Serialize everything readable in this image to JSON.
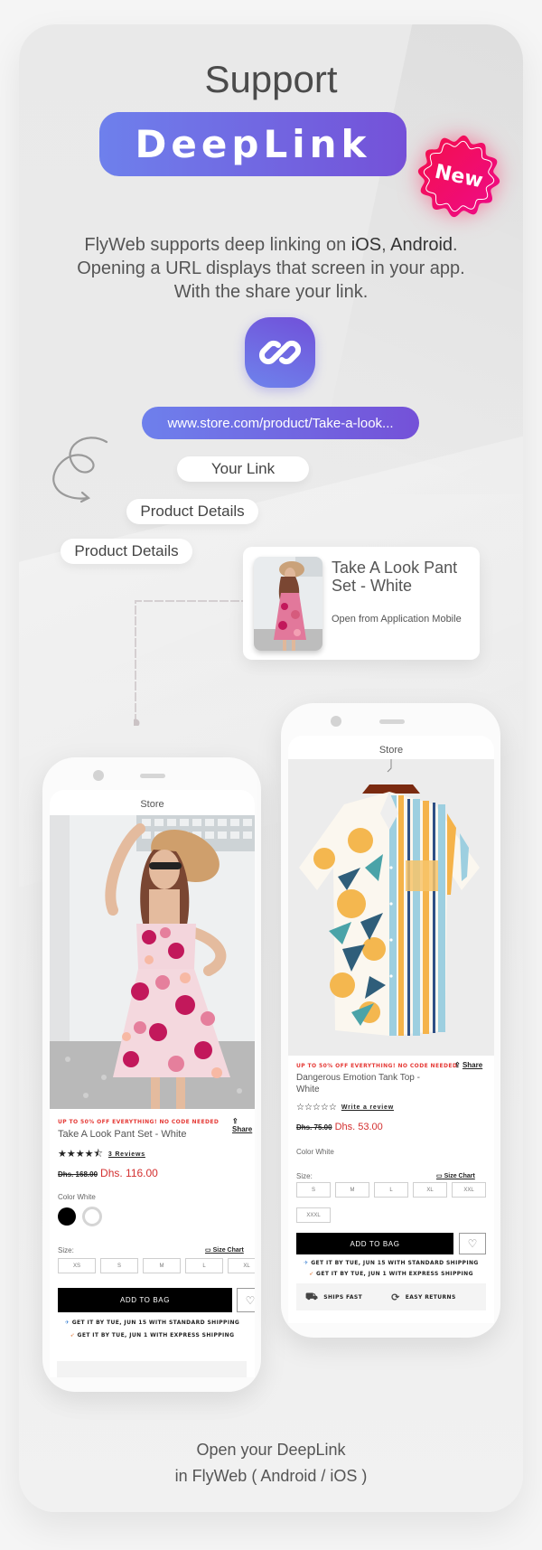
{
  "header": {
    "title": "Support",
    "badge_label": "DeepLink",
    "new_badge": "New",
    "description": {
      "line1_prefix": "FlyWeb supports deep linking on ",
      "line1_ios": "iOS",
      "line1_sep": ", ",
      "line1_android": "Android",
      "line1_suffix": ".",
      "line2": "Opening a URL displays that screen in your app.",
      "line3": "With the share your link."
    }
  },
  "flow": {
    "link_icon": "link-chain-icon",
    "url": "www.store.com/product/Take-a-look...",
    "chips": [
      "Your Link",
      "Product Details",
      "Product Details"
    ]
  },
  "preview_card": {
    "title": "Take A Look Pant Set - White",
    "subtitle": "Open from Application Mobile",
    "image": "woman-floral-dress-photo"
  },
  "phone_left": {
    "app_title": "Store",
    "image": "woman-floral-dress-photo",
    "promo": "UP TO 50% OFF EVERYTHING! NO CODE NEEDED",
    "share_label": "Share",
    "product_name": "Take A Look Pant Set - White",
    "rating": 4.5,
    "stars": "★★★★⯪",
    "reviews": "3 Reviews",
    "old_price": "Dhs. 168.00",
    "new_price": "Dhs. 116.00",
    "color_label": "Color White",
    "colors": [
      "#000000",
      "#ffffff"
    ],
    "size_label": "Size:",
    "size_chart": "Size Chart",
    "sizes": [
      "XS",
      "S",
      "M",
      "L",
      "XL"
    ],
    "add_to_bag": "ADD TO BAG",
    "ship_standard": "GET IT BY TUE, JUN 15 WITH STANDARD SHIPPING",
    "ship_express": "GET IT BY TUE, JUN 1 WITH EXPRESS SHIPPING"
  },
  "phone_right": {
    "app_title": "Store",
    "image": "floral-striped-shirt-photo",
    "promo": "UP TO 50% OFF EVERYTHING! NO CODE NEEDED",
    "share_label": "Share",
    "product_name": "Dangerous Emotion Tank Top - White",
    "rating": 0,
    "stars": "☆☆☆☆☆",
    "reviews": "Write a review",
    "old_price": "Dhs. 75.00",
    "new_price": "Dhs. 53.00",
    "color_label": "Color White",
    "size_label": "Size:",
    "size_chart": "Size Chart",
    "sizes": [
      "S",
      "M",
      "L",
      "XL",
      "XXL",
      "XXXL"
    ],
    "add_to_bag": "ADD TO BAG",
    "ship_standard": "GET IT BY TUE, JUN 15 WITH STANDARD SHIPPING",
    "ship_express": "GET IT BY TUE, JUN 1 WITH EXPRESS SHIPPING",
    "features": [
      "SHIPS FAST",
      "EASY RETURNS"
    ]
  },
  "footer": {
    "line1": "Open your DeepLink",
    "line2": "in FlyWeb ( Android / iOS )"
  },
  "colors": {
    "gradient_start": "#6e80ec",
    "gradient_end": "#7451d8",
    "new_badge": "#f0105a",
    "sale_price": "#d32f2f",
    "promo": "#e53935"
  }
}
